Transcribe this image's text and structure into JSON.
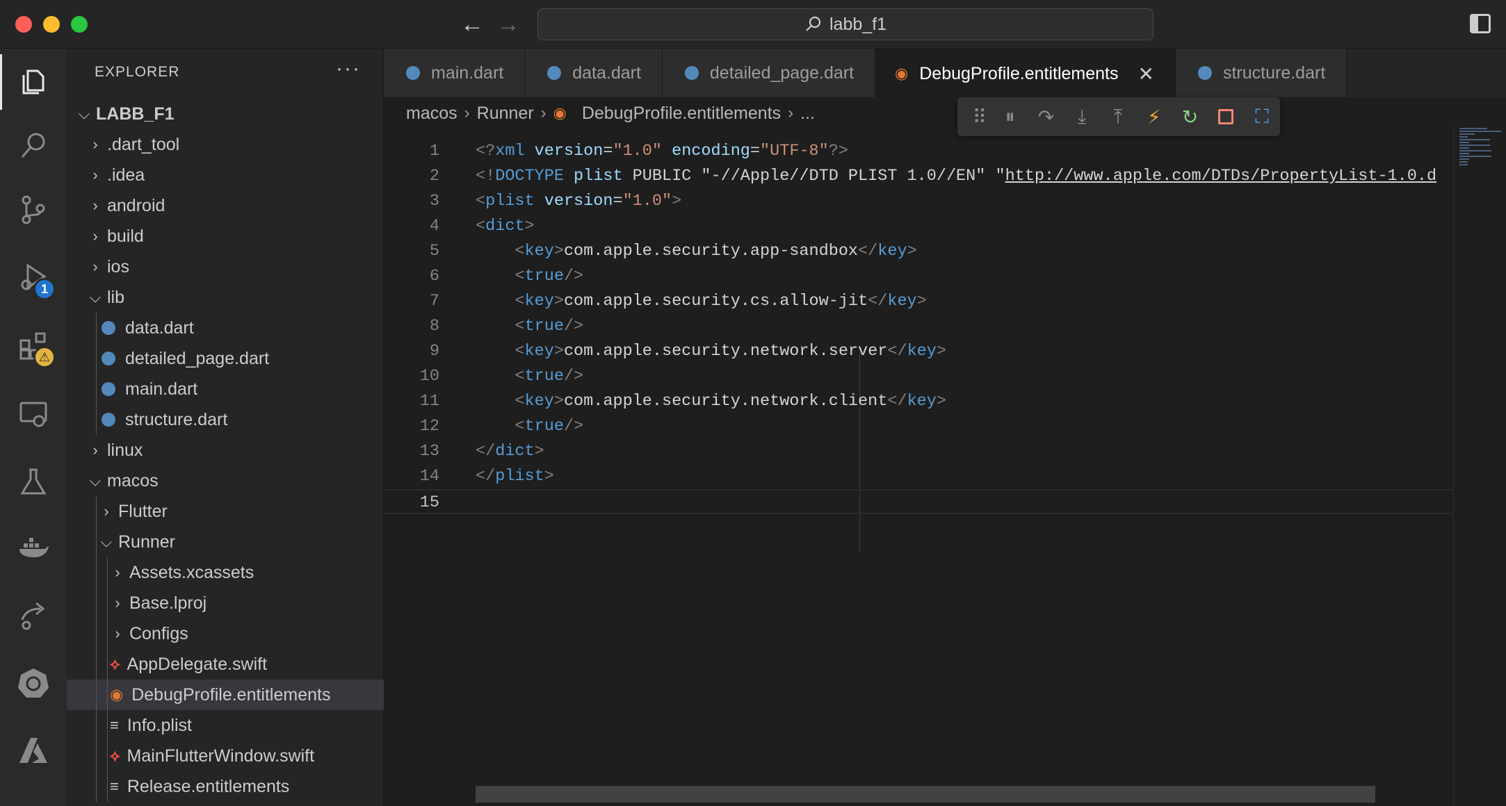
{
  "window": {
    "search_text": "labb_f1"
  },
  "sidebar": {
    "header": "EXPLORER",
    "more_label": "···",
    "tree": [
      {
        "label": "LABB_F1",
        "chevron": "⌵",
        "bold": true
      },
      {
        "label": ".dart_tool",
        "chevron": "›"
      },
      {
        "label": ".idea",
        "chevron": "›"
      },
      {
        "label": "android",
        "chevron": "›"
      },
      {
        "label": "build",
        "chevron": "›"
      },
      {
        "label": "ios",
        "chevron": "›"
      },
      {
        "label": "lib",
        "chevron": "⌵"
      },
      {
        "label": "data.dart",
        "icon": "dart"
      },
      {
        "label": "detailed_page.dart",
        "icon": "dart"
      },
      {
        "label": "main.dart",
        "icon": "dart"
      },
      {
        "label": "structure.dart",
        "icon": "dart"
      },
      {
        "label": "linux",
        "chevron": "›"
      },
      {
        "label": "macos",
        "chevron": "⌵"
      },
      {
        "label": "Flutter",
        "chevron": "›"
      },
      {
        "label": "Runner",
        "chevron": "⌵"
      },
      {
        "label": "Assets.xcassets",
        "chevron": "›"
      },
      {
        "label": "Base.lproj",
        "chevron": "›"
      },
      {
        "label": "Configs",
        "chevron": "›"
      },
      {
        "label": "AppDelegate.swift",
        "icon": "swift"
      },
      {
        "label": "DebugProfile.entitlements",
        "icon": "rss",
        "selected": true
      },
      {
        "label": "Info.plist",
        "icon": "plist"
      },
      {
        "label": "MainFlutterWindow.swift",
        "icon": "swift"
      },
      {
        "label": "Release.entitlements",
        "icon": "plist"
      }
    ]
  },
  "activity": {
    "debug_badge": "1",
    "extensions_badge": "⚠"
  },
  "tabs": [
    {
      "label": "main.dart",
      "icon": "dart"
    },
    {
      "label": "data.dart",
      "icon": "dart"
    },
    {
      "label": "detailed_page.dart",
      "icon": "dart"
    },
    {
      "label": "DebugProfile.entitlements",
      "icon": "rss",
      "active": true
    },
    {
      "label": "structure.dart",
      "icon": "dart"
    }
  ],
  "breadcrumb": {
    "part1": "macos",
    "part2": "Runner",
    "part3": "DebugProfile.entitlements",
    "part4": "..."
  },
  "editor": {
    "lines": [
      {
        "n": "1",
        "tokens": [
          [
            "punc",
            "<?"
          ],
          [
            "tag",
            "xml"
          ],
          [
            "text",
            " "
          ],
          [
            "attr",
            "version"
          ],
          [
            "text",
            "="
          ],
          [
            "str",
            "\"1.0\""
          ],
          [
            "text",
            " "
          ],
          [
            "attr",
            "encoding"
          ],
          [
            "text",
            "="
          ],
          [
            "str",
            "\"UTF-8\""
          ],
          [
            "punc",
            "?>"
          ]
        ]
      },
      {
        "n": "2",
        "tokens": [
          [
            "punc",
            "<!"
          ],
          [
            "tag",
            "DOCTYPE"
          ],
          [
            "text",
            " "
          ],
          [
            "attr",
            "plist"
          ],
          [
            "text",
            " PUBLIC \"-//Apple//DTD PLIST 1.0//EN\" \""
          ],
          [
            "link",
            "http://www.apple.com/DTDs/PropertyList-1.0.d"
          ]
        ]
      },
      {
        "n": "3",
        "tokens": [
          [
            "punc",
            "<"
          ],
          [
            "tag",
            "plist"
          ],
          [
            "text",
            " "
          ],
          [
            "attr",
            "version"
          ],
          [
            "text",
            "="
          ],
          [
            "str",
            "\"1.0\""
          ],
          [
            "punc",
            ">"
          ]
        ]
      },
      {
        "n": "4",
        "tokens": [
          [
            "punc",
            "<"
          ],
          [
            "tag",
            "dict"
          ],
          [
            "punc",
            ">"
          ]
        ]
      },
      {
        "n": "5",
        "tokens": [
          [
            "text",
            "    "
          ],
          [
            "punc",
            "<"
          ],
          [
            "tag",
            "key"
          ],
          [
            "punc",
            ">"
          ],
          [
            "text",
            "com.apple.security.app-sandbox"
          ],
          [
            "punc",
            "</"
          ],
          [
            "tag",
            "key"
          ],
          [
            "punc",
            ">"
          ]
        ]
      },
      {
        "n": "6",
        "tokens": [
          [
            "text",
            "    "
          ],
          [
            "punc",
            "<"
          ],
          [
            "tag",
            "true"
          ],
          [
            "punc",
            "/>"
          ]
        ]
      },
      {
        "n": "7",
        "tokens": [
          [
            "text",
            "    "
          ],
          [
            "punc",
            "<"
          ],
          [
            "tag",
            "key"
          ],
          [
            "punc",
            ">"
          ],
          [
            "text",
            "com.apple.security.cs.allow-jit"
          ],
          [
            "punc",
            "</"
          ],
          [
            "tag",
            "key"
          ],
          [
            "punc",
            ">"
          ]
        ]
      },
      {
        "n": "8",
        "tokens": [
          [
            "text",
            "    "
          ],
          [
            "punc",
            "<"
          ],
          [
            "tag",
            "true"
          ],
          [
            "punc",
            "/>"
          ]
        ]
      },
      {
        "n": "9",
        "tokens": [
          [
            "text",
            "    "
          ],
          [
            "punc",
            "<"
          ],
          [
            "tag",
            "key"
          ],
          [
            "punc",
            ">"
          ],
          [
            "text",
            "com.apple.security.network.server"
          ],
          [
            "punc",
            "</"
          ],
          [
            "tag",
            "key"
          ],
          [
            "punc",
            ">"
          ]
        ]
      },
      {
        "n": "10",
        "tokens": [
          [
            "text",
            "    "
          ],
          [
            "punc",
            "<"
          ],
          [
            "tag",
            "true"
          ],
          [
            "punc",
            "/>"
          ]
        ]
      },
      {
        "n": "11",
        "tokens": [
          [
            "text",
            "    "
          ],
          [
            "punc",
            "<"
          ],
          [
            "tag",
            "key"
          ],
          [
            "punc",
            ">"
          ],
          [
            "text",
            "com.apple.security.network.client"
          ],
          [
            "punc",
            "</"
          ],
          [
            "tag",
            "key"
          ],
          [
            "punc",
            ">"
          ]
        ]
      },
      {
        "n": "12",
        "tokens": [
          [
            "text",
            "    "
          ],
          [
            "punc",
            "<"
          ],
          [
            "tag",
            "true"
          ],
          [
            "punc",
            "/>"
          ]
        ]
      },
      {
        "n": "13",
        "tokens": [
          [
            "punc",
            "</"
          ],
          [
            "tag",
            "dict"
          ],
          [
            "punc",
            ">"
          ]
        ]
      },
      {
        "n": "14",
        "tokens": [
          [
            "punc",
            "</"
          ],
          [
            "tag",
            "plist"
          ],
          [
            "punc",
            ">"
          ]
        ]
      },
      {
        "n": "15",
        "tokens": [],
        "current": true
      }
    ]
  }
}
